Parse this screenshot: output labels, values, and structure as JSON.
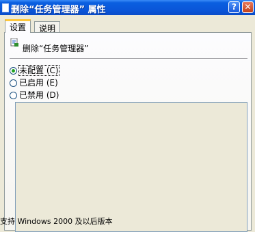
{
  "window": {
    "title": "删除“任务管理器” 属性",
    "help_label": "?",
    "close_label": "✕"
  },
  "tabs": [
    {
      "label": "设置",
      "active": true
    },
    {
      "label": "说明",
      "active": false
    }
  ],
  "policy": {
    "icon": "policy-setting-icon",
    "name": "删除“任务管理器”"
  },
  "options": [
    {
      "label": "未配置 (C)",
      "checked": true
    },
    {
      "label": "已启用 (E)",
      "checked": false
    },
    {
      "label": "已禁用 (D)",
      "checked": false
    }
  ],
  "bottom_text": "支持 Windows 2000 及以后版本"
}
